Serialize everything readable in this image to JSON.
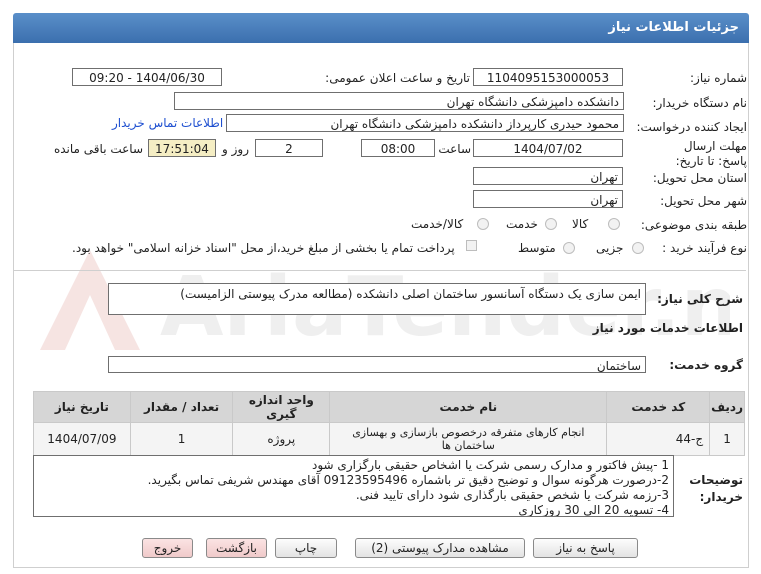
{
  "header": {
    "title": "جزئیات اطلاعات نیاز"
  },
  "fields": {
    "need_number_label": "شماره نیاز:",
    "need_number": "1104095153000053",
    "announce_label": "تاریخ و ساعت اعلان عمومی:",
    "announce_value": "1404/06/30 - 09:20",
    "buyer_org_label": "نام دستگاه خریدار:",
    "buyer_org": "دانشکده دامپزشکی دانشگاه تهران",
    "creator_label": "ایجاد کننده درخواست:",
    "creator": "محمود حیدری کارپرداز دانشکده دامپزشکی دانشگاه تهران",
    "contact_link": "اطلاعات تماس خریدار",
    "deadline_label": "مهلت ارسال پاسخ: تا تاریخ:",
    "deadline_date": "1404/07/02",
    "time_label": "ساعت",
    "deadline_time": "08:00",
    "days": "2",
    "days_label": "روز و",
    "remaining_time": "17:51:04",
    "remaining_label": "ساعت باقی مانده",
    "province_label": "استان محل تحویل:",
    "province": "تهران",
    "city_label": "شهر محل تحویل:",
    "city": "تهران",
    "category_label": "طبقه بندی موضوعی:",
    "category_options": [
      "کالا",
      "خدمت",
      "کالا/خدمت"
    ],
    "process_label": "نوع فرآیند خرید :",
    "process_options": [
      "جزیی",
      "متوسط"
    ],
    "payment_note": "پرداخت تمام یا بخشی از مبلغ خرید،از محل \"اسناد خزانه اسلامی\" خواهد بود."
  },
  "summary": {
    "label": "شرح کلی نیاز:",
    "value": "ایمن سازی یک دستگاه آسانسور ساختمان اصلی دانشکده (مطالعه مدرک پیوستی الزامیست)"
  },
  "services": {
    "section_title": "اطلاعات خدمات مورد نیاز",
    "group_label": "گروه خدمت:",
    "group_value": "ساختمان",
    "columns": [
      "ردیف",
      "کد خدمت",
      "نام خدمت",
      "واحد اندازه گیری",
      "تعداد / مقدار",
      "تاریخ نیاز"
    ],
    "rows": [
      {
        "index": "1",
        "code": "ج-44",
        "name": "انجام کارهای متفرقه درخصوص بازسازی و بهسازی ساختمان ها",
        "unit": "پروژه",
        "qty": "1",
        "date": "1404/07/09"
      }
    ]
  },
  "notes": {
    "label": "توضیحات خریدار:",
    "lines": [
      "1 -پیش فاکتور و مدارک رسمی شرکت  یا اشخاص حقیقی بارگزاری  شود",
      "2-درصورت هرگونه سوال و توضیح دقیق تر باشماره 09123595496 آقای مهندس شریفی تماس بگیرید.",
      "3-رزمه شرکت یا شخص حقیقی بارگذاری شود دارای تایید فنی.",
      "4- تسویه 20 الی 30 روزکاری"
    ]
  },
  "buttons": {
    "reply": "پاسخ به نیاز",
    "attachments": "مشاهده مدارک پیوستی (2)",
    "print": "چاپ",
    "back": "بازگشت",
    "exit": "خروج"
  },
  "watermark": "AriaTender.net",
  "colors": {
    "header": "#4a7fbf",
    "link": "#1e4fd0",
    "highlight": "#f5eec4"
  }
}
